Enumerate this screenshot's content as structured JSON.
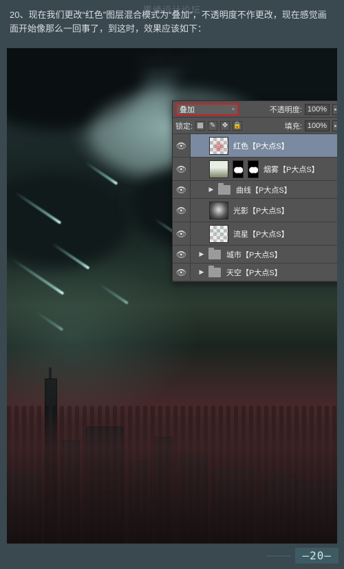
{
  "watermark": "思缘设计论坛",
  "instruction": {
    "step_prefix": "20、",
    "text": "现在我们更改“红色”图层混合模式为“叠加”，不透明度不作更改，现在感觉画面开始像那么一回事了，到这时，效果应该如下："
  },
  "panel": {
    "row1": {
      "blend_mode": "叠加",
      "opacity_label": "不透明度:",
      "opacity_value": "100%"
    },
    "row2": {
      "lock_label": "锁定:",
      "fill_label": "填充:",
      "fill_value": "100%"
    },
    "layers": [
      {
        "name": "红色【P大点S】",
        "type": "layer",
        "selected": true,
        "thumb": "red",
        "indent": 1
      },
      {
        "name": "烟雾【P大点S】",
        "type": "layer-mask",
        "thumb": "fog",
        "indent": 1
      },
      {
        "name": "曲线【P大点S】",
        "type": "group",
        "indent": 1
      },
      {
        "name": "光影【P大点S】",
        "type": "layer",
        "thumb": "light",
        "indent": 1
      },
      {
        "name": "流星【P大点S】",
        "type": "layer",
        "thumb": "meteor-th",
        "indent": 1
      },
      {
        "name": "城市【P大点S】",
        "type": "group",
        "indent": 0
      },
      {
        "name": "天空【P大点S】",
        "type": "group",
        "indent": 0
      }
    ]
  },
  "page_number": "—20—"
}
